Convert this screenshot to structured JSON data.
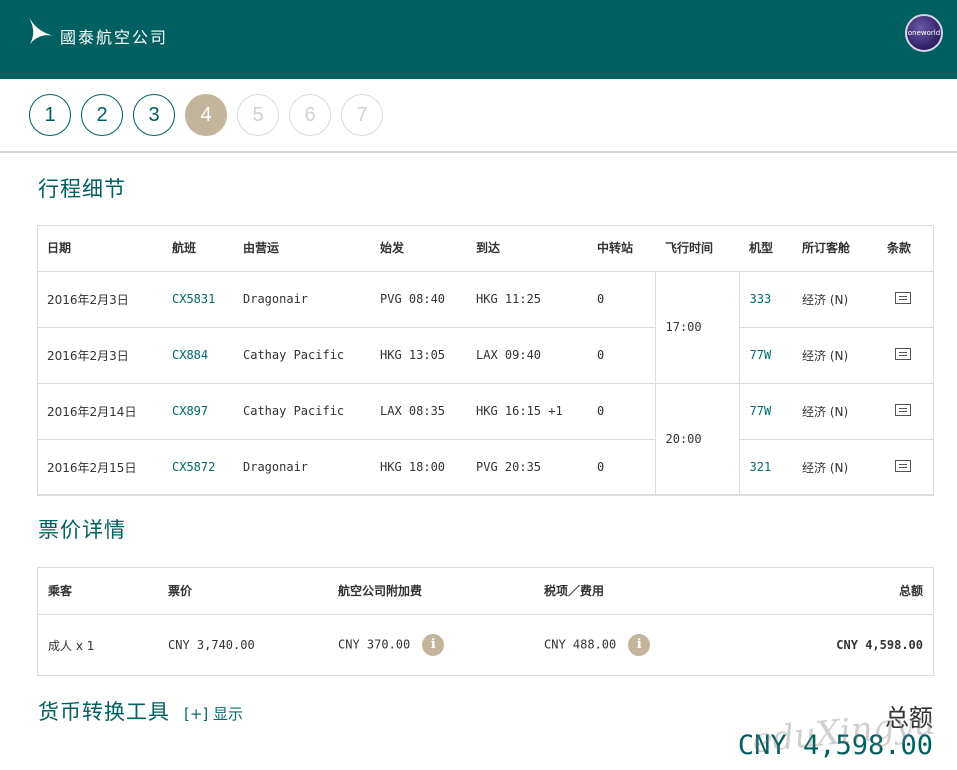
{
  "header": {
    "airline_name": "國泰航空公司",
    "alliance_label": "oneworld"
  },
  "steps": [
    "1",
    "2",
    "3",
    "4",
    "5",
    "6",
    "7"
  ],
  "itinerary": {
    "title": "行程细节",
    "columns": [
      "日期",
      "航班",
      "由营运",
      "始发",
      "到达",
      "中转站",
      "飞行时间",
      "机型",
      "所订客舱",
      "条款"
    ],
    "rows": [
      {
        "date": "2016年2月3日",
        "flight": "CX5831",
        "operator": "Dragonair",
        "depart": "PVG 08:40",
        "arrive": "HKG 11:25",
        "stops": "0",
        "aircraft": "333",
        "cabin": "经济 (N)"
      },
      {
        "date": "2016年2月3日",
        "flight": "CX884",
        "operator": "Cathay Pacific",
        "depart": "HKG 13:05",
        "arrive": "LAX 09:40",
        "stops": "0",
        "aircraft": "77W",
        "cabin": "经济 (N)"
      },
      {
        "date": "2016年2月14日",
        "flight": "CX897",
        "operator": "Cathay Pacific",
        "depart": "LAX 08:35",
        "arrive": "HKG 16:15 +1",
        "stops": "0",
        "aircraft": "77W",
        "cabin": "经济 (N)"
      },
      {
        "date": "2016年2月15日",
        "flight": "CX5872",
        "operator": "Dragonair",
        "depart": "HKG 18:00",
        "arrive": "PVG 20:35",
        "stops": "0",
        "aircraft": "321",
        "cabin": "经济 (N)"
      }
    ],
    "durations": [
      "17:00",
      "20:00"
    ]
  },
  "fare": {
    "title": "票价详情",
    "columns": [
      "乘客",
      "票价",
      "航空公司附加费",
      "税项／费用",
      "总额"
    ],
    "row": {
      "passenger": "成人 x 1",
      "fare": "CNY 3,740.00",
      "surcharge": "CNY 370.00",
      "taxes": "CNY 488.00",
      "total": "CNY 4,598.00"
    },
    "info_glyph": "i"
  },
  "currency": {
    "title": "货币转换工具",
    "toggle_label": "[+] 显示"
  },
  "grand_total": {
    "label": "总额",
    "amount": "CNY 4,598.00"
  },
  "watermark": "eduXingyu"
}
